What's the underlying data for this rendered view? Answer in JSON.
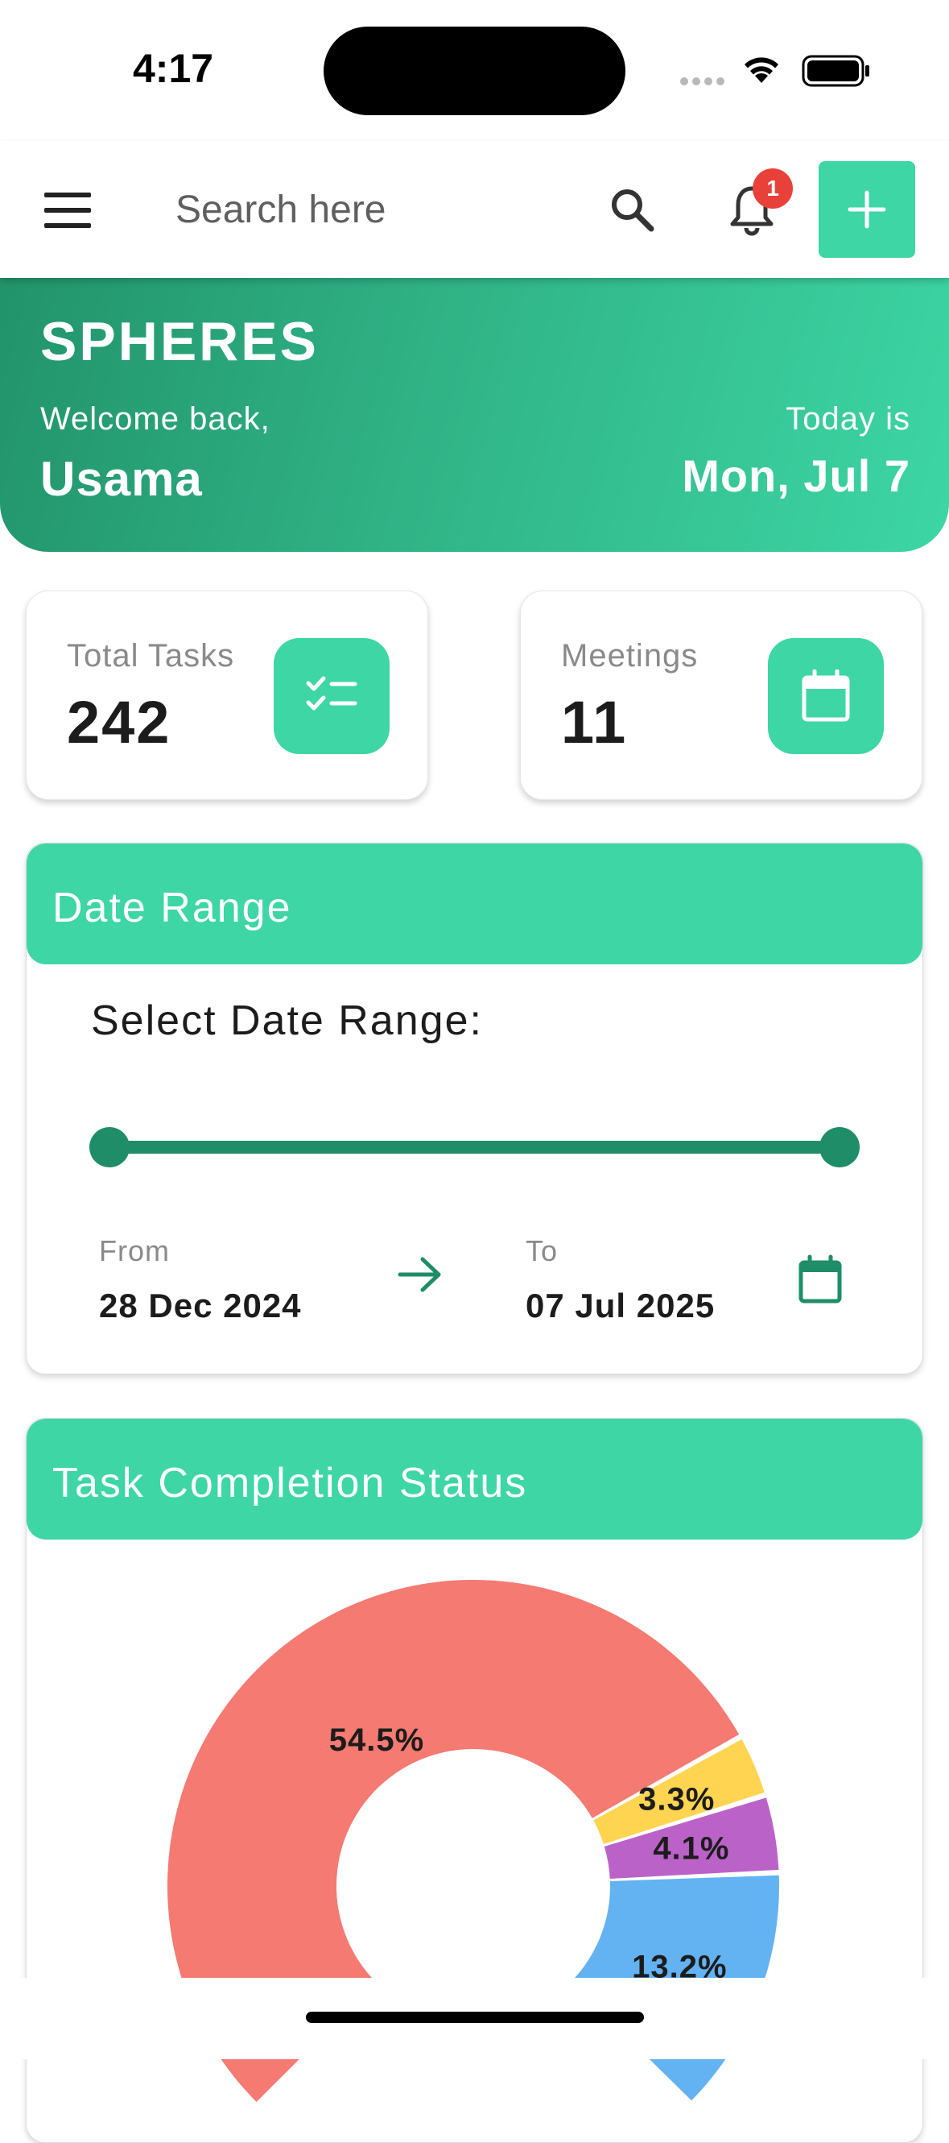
{
  "status_bar": {
    "time": "4:17"
  },
  "app_bar": {
    "search_placeholder": "Search here",
    "notification_count": "1"
  },
  "hero": {
    "title": "SPHERES",
    "welcome": "Welcome back,",
    "user_name": "Usama",
    "today_label": "Today is",
    "date": "Mon, Jul 7"
  },
  "stats": {
    "tasks_label": "Total Tasks",
    "tasks_value": "242",
    "meetings_label": "Meetings",
    "meetings_value": "11"
  },
  "date_range": {
    "header": "Date Range",
    "select_label": "Select Date Range:",
    "from_label": "From",
    "from_value": "28 Dec 2024",
    "to_label": "To",
    "to_value": "07 Jul 2025"
  },
  "task_completion": {
    "header": "Task Completion Status"
  },
  "chart_data": {
    "type": "pie",
    "title": "Task Completion Status",
    "slices": [
      {
        "label": "54.5%",
        "value": 54.5,
        "color": "#f47a72"
      },
      {
        "label": "3.3%",
        "value": 3.3,
        "color": "#ffd451"
      },
      {
        "label": "4.1%",
        "value": 4.1,
        "color": "#bb62c8"
      },
      {
        "label": "13.2%",
        "value": 13.2,
        "color": "#63b2f2"
      }
    ]
  },
  "colors": {
    "accent": "#3dd6a4",
    "accent_dark": "#1f8d67",
    "badge": "#e8413a"
  }
}
